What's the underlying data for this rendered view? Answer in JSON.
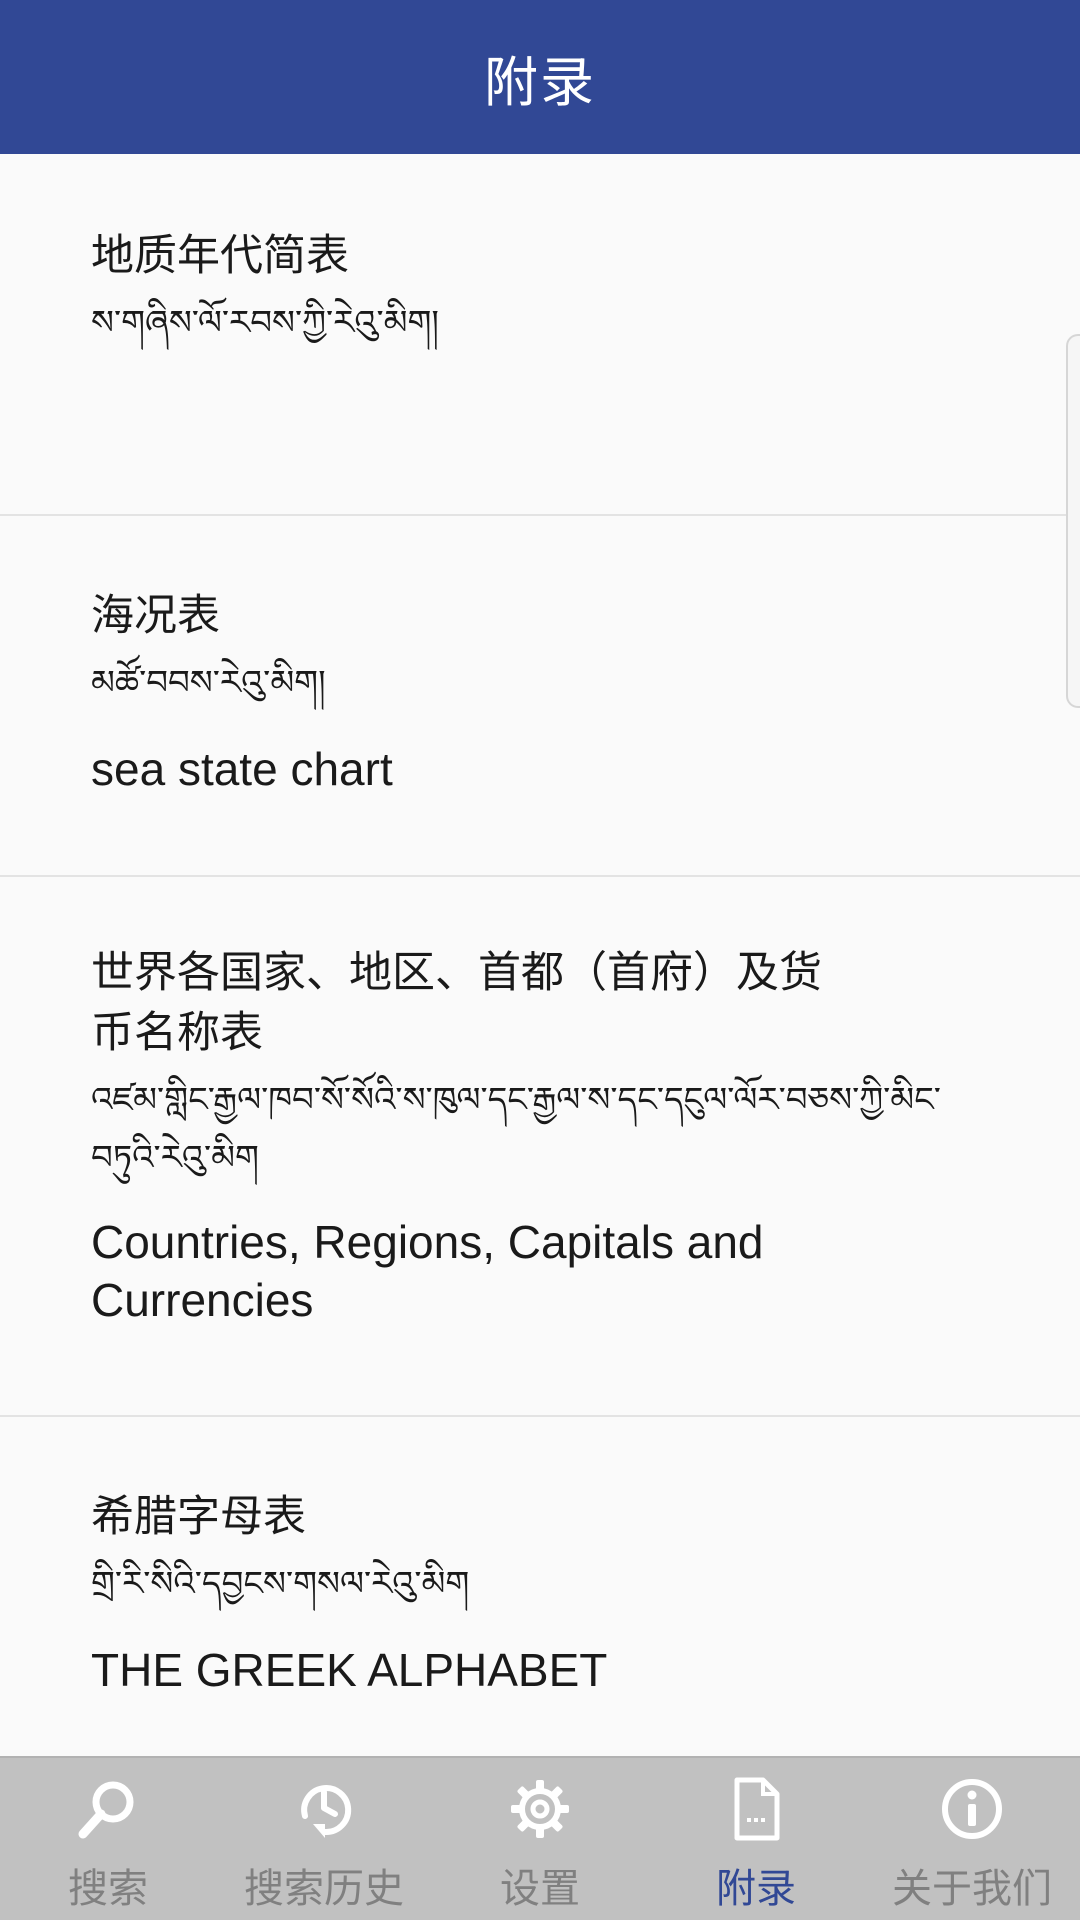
{
  "header": {
    "title": "附录"
  },
  "entries": [
    {
      "zh": "地质年代简表",
      "bo": "ས་གཞིས་ལོ་རབས་ཀྱི་རེའུ་མིག།",
      "en": ""
    },
    {
      "zh": "海况表",
      "bo": "མཚོ་བབས་རེའུ་མིག།",
      "en": "sea state chart"
    },
    {
      "zh": "世界各国家、地区、首都（首府）及货币名称表",
      "bo": "འཛམ་གླིང་རྒྱལ་ཁབ་སོ་སོའི་ས་ཁུལ་དང་རྒྱལ་ས་དང་དངུལ་ལོར་བཅས་ཀྱི་མིང་བཏུའི་རེའུ་མིག",
      "en": "Countries, Regions, Capitals and Currencies"
    },
    {
      "zh": "希腊字母表",
      "bo": "གྲི་རི་སིའི་དབྱངས་གསལ་རེའུ་མིག",
      "en": "THE GREEK ALPHABET"
    }
  ],
  "nav": {
    "items": [
      {
        "label": "搜索",
        "icon": "search-icon"
      },
      {
        "label": "搜索历史",
        "icon": "history-icon"
      },
      {
        "label": "设置",
        "icon": "gear-icon"
      },
      {
        "label": "附录",
        "icon": "document-icon"
      },
      {
        "label": "关于我们",
        "icon": "info-icon"
      }
    ],
    "active_index": 3
  },
  "colors": {
    "header_bg": "#314895",
    "active": "#314895",
    "inactive": "#808080",
    "nav_bg": "#c1c1c1"
  }
}
